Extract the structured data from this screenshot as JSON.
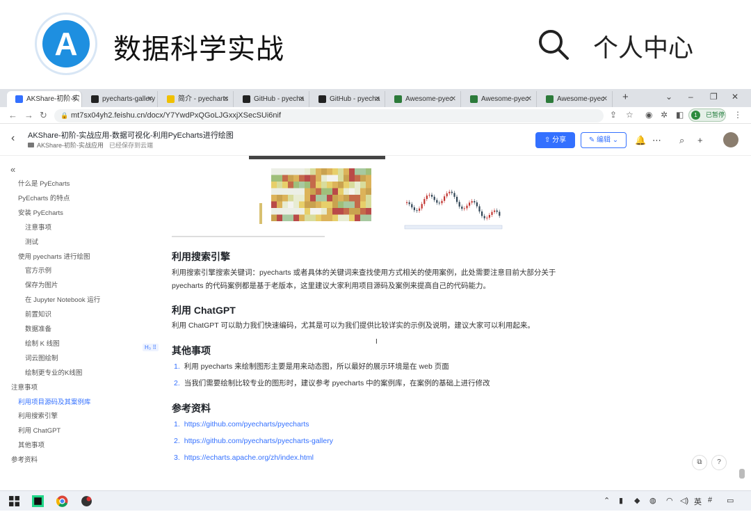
{
  "site": {
    "logo_letter": "A",
    "title": "数据科学实战",
    "personal_center": "个人中心"
  },
  "tabs": [
    {
      "label": "AKShare-初阶-实",
      "color": "#3370ff",
      "active": true
    },
    {
      "label": "pyecharts-gallery",
      "color": "#222"
    },
    {
      "label": "简介 - pyecharts",
      "color": "#f0c000"
    },
    {
      "label": "GitHub - pyecha",
      "color": "#222"
    },
    {
      "label": "GitHub - pyecha",
      "color": "#222"
    },
    {
      "label": "Awesome-pyec",
      "color": "#2c7a3a"
    },
    {
      "label": "Awesome-pyec",
      "color": "#2c7a3a"
    },
    {
      "label": "Awesome-pyec",
      "color": "#2c7a3a"
    }
  ],
  "omnibox": {
    "url": "mt7sx04yh2.feishu.cn/docx/Y7YwdPxQGoLJGxxjXSecSUi6nif",
    "profile_initial": "1",
    "profile_status": "已暂停"
  },
  "doc": {
    "title": "AKShare-初阶-实战应用-数据可视化-利用PyEcharts进行绘图",
    "breadcrumb": "AKShare-初阶-实战应用",
    "saved_status": "已经保存到云端",
    "share_label": "分享",
    "edit_label": "编辑"
  },
  "toc": [
    {
      "label": "什么是 PyEcharts",
      "level": 1
    },
    {
      "label": "PyEcharts 的特点",
      "level": 1
    },
    {
      "label": "安装 PyEcharts",
      "level": 1
    },
    {
      "label": "注意事项",
      "level": 2
    },
    {
      "label": "测试",
      "level": 2
    },
    {
      "label": "使用 pyecharts 进行绘图",
      "level": 1
    },
    {
      "label": "官方示例",
      "level": 2
    },
    {
      "label": "保存为图片",
      "level": 2
    },
    {
      "label": "在 Jupyter Notebook 运行",
      "level": 2
    },
    {
      "label": "前置知识",
      "level": 2
    },
    {
      "label": "数据准备",
      "level": 2
    },
    {
      "label": "绘制 K 线图",
      "level": 2
    },
    {
      "label": "词云图绘制",
      "level": 2
    },
    {
      "label": "绘制更专业的K线图",
      "level": 2
    },
    {
      "label": "注意事项",
      "level": 0
    },
    {
      "label": "利用项目源码及其案例库",
      "level": 1,
      "active": true
    },
    {
      "label": "利用搜索引擎",
      "level": 1
    },
    {
      "label": "利用 ChatGPT",
      "level": 1
    },
    {
      "label": "其他事项",
      "level": 1
    },
    {
      "label": "参考资料",
      "level": 0
    }
  ],
  "sections": {
    "search_title": "利用搜索引擎",
    "search_body": "利用搜索引擎搜索关键词：pyecharts 或者具体的关键词来查找使用方式相关的使用案例，此处需要注意目前大部分关于 pyecharts 的代码案例都是基于老版本，这里建议大家利用项目源码及案例来提高自己的代码能力。",
    "chatgpt_title": "利用 ChatGPT",
    "chatgpt_body": "利用 ChatGPT 可以助力我们快速编码，尤其是可以为我们提供比较详实的示例及说明，建议大家可以利用起来。",
    "other_title": "其他事项",
    "other_items": [
      "利用 pyecharts 来绘制图形主要是用来动态图，所以最好的展示环境是在 web 页面",
      "当我们需要绘制比较专业的图形时，建议参考 pyecharts 中的案例库，在案例的基础上进行修改"
    ],
    "refs_title": "参考资料",
    "refs": [
      "https://github.com/pyecharts/pyecharts",
      "https://github.com/pyecharts/pyecharts-gallery",
      "https://echarts.apache.org/zh/index.html"
    ]
  },
  "taskbar": {
    "ime": "英"
  }
}
